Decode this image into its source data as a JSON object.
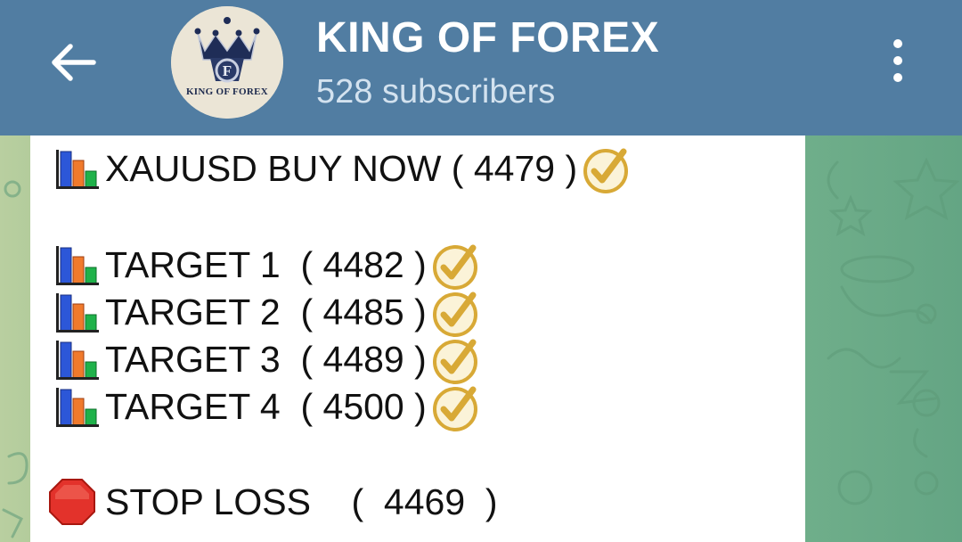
{
  "header": {
    "title": "KING OF FOREX",
    "subscribers": "528 subscribers",
    "avatar_text": "KING OF FOREX",
    "back_icon": "arrow-left-icon",
    "menu_icon": "more-vertical-icon"
  },
  "message": {
    "entry": {
      "text": "XAUUSD BUY NOW ( 4479 )"
    },
    "targets": [
      {
        "text": "TARGET 1  ( 4482 )"
      },
      {
        "text": "TARGET 2  ( 4485 )"
      },
      {
        "text": "TARGET 3  ( 4489 )"
      },
      {
        "text": "TARGET 4  ( 4500 )"
      }
    ],
    "stop_loss": {
      "text": "STOP LOSS    (  4469  )"
    }
  },
  "colors": {
    "header_bg": "#517da2",
    "subtitle": "#d3e2ef",
    "bubble_bg": "#ffffff",
    "check_gold": "#d8a936",
    "stop_red": "#e3322b"
  }
}
